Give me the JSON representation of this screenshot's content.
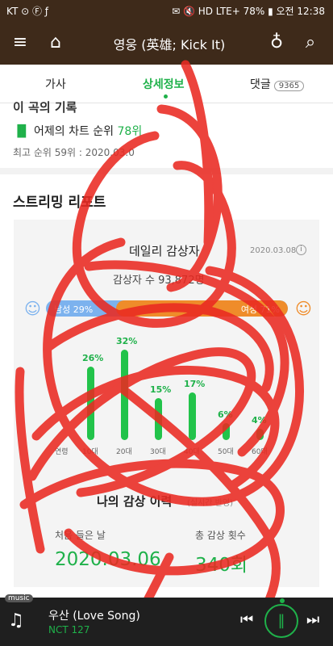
{
  "status": {
    "left": "KT ⊙ Ⓕ ƒ",
    "right": "✉ 🔇 HD LTE+ 78% ▮ 오전 12:38"
  },
  "appbar": {
    "title": "영웅 (英雄; Kick It)",
    "menu_icon": "≡",
    "home_icon": "⌂",
    "mic_icon": "♁",
    "search_icon": "⌕"
  },
  "tabs": {
    "lyrics": "가사",
    "details": "상세정보",
    "comments": "댓글",
    "comment_count": "9365"
  },
  "record": {
    "heading_partial": "이 곡의 기록",
    "yesterday_label": "어제의 차트 순위",
    "yesterday_rank": "78위",
    "best_rank": "최고 순위 59위 : 2020.03.0"
  },
  "streaming": {
    "heading": "스트리밍 리포트",
    "daily_title": "데일리 감상자",
    "date": "2020.03.08",
    "listeners": "감상자 수 93,872명",
    "male_label": "남성 29%",
    "female_label": "여성 71%",
    "female_share": 0.71,
    "age_label": "연령",
    "age_groups": [
      "10대",
      "20대",
      "30대",
      "40대",
      "50대",
      "60대"
    ],
    "age_pct_labels": [
      "26%",
      "32%",
      "15%",
      "17%",
      "6%",
      "4%"
    ],
    "age_values": [
      26,
      32,
      15,
      17,
      6,
      4
    ]
  },
  "my_record": {
    "heading": "나의 감상 이력",
    "sub": "(실시간 반영)",
    "first_label": "처음 들은 날",
    "first_value": "2020.03.06",
    "count_label": "총 감상 횟수",
    "count_value": "340회"
  },
  "player": {
    "badge": "music",
    "track": "우산 (Love Song)",
    "artist": "NCT 127",
    "prev_icon": "⏮",
    "pause_icon": "‖",
    "next_icon": "⏭"
  },
  "colors": {
    "appbar": "#3e2a1a",
    "accent_green": "#1fb14a",
    "male_blue": "#7cb2ee",
    "female_orange": "#ef8c2a",
    "scribble_red": "#ea2a22"
  }
}
